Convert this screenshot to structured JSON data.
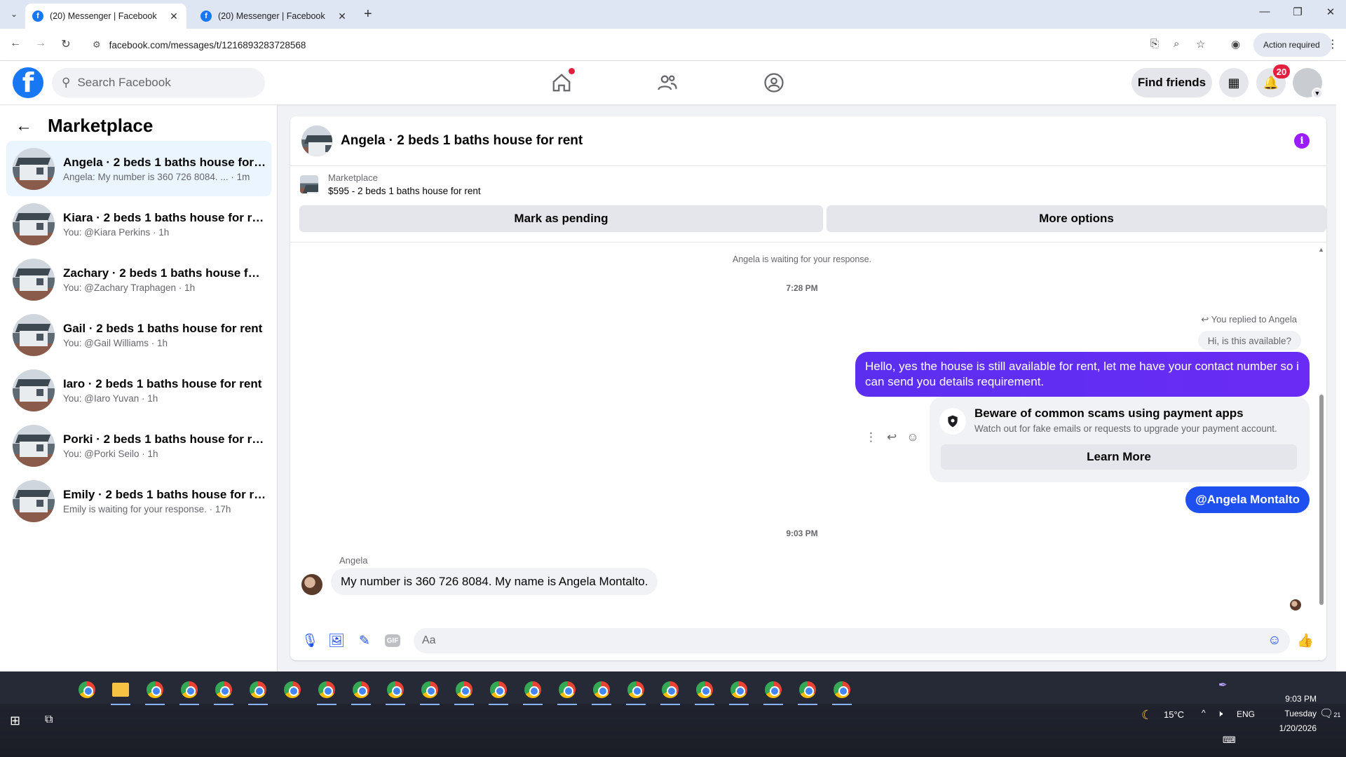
{
  "browser": {
    "tabs": [
      {
        "title": "(20) Messenger | Facebook",
        "active": true
      },
      {
        "title": "(20) Messenger | Facebook",
        "active": false
      }
    ],
    "url": "facebook.com/messages/t/1216893283728568",
    "action_required": "Action required"
  },
  "fb_header": {
    "search_placeholder": "Search Facebook",
    "find_friends": "Find friends",
    "notification_count": "20"
  },
  "sidebar": {
    "title": "Marketplace",
    "conversations": [
      {
        "name": "Angela · 2 beds 1 baths house for r...",
        "sub": "Angela: My number is 360 726 8084. ... · 1m",
        "active": true
      },
      {
        "name": "Kiara · 2 beds 1 baths house for rent",
        "sub": "You: @Kiara Perkins · 1h"
      },
      {
        "name": "Zachary · 2 beds 1 baths house for ...",
        "sub": "You: @Zachary Traphagen · 1h"
      },
      {
        "name": "Gail · 2 beds 1 baths house for rent",
        "sub": "You: @Gail Williams · 1h"
      },
      {
        "name": "Iaro · 2 beds 1 baths house for rent",
        "sub": "You: @Iaro Yuvan · 1h"
      },
      {
        "name": "Porki · 2 beds 1 baths house for rent",
        "sub": "You: @Porki Seilo · 1h"
      },
      {
        "name": "Emily · 2 beds 1 baths house for rent",
        "sub": "Emily is waiting for your response. · 17h"
      }
    ]
  },
  "chat": {
    "title": "Angela · 2 beds 1 baths house for rent",
    "listing_category": "Marketplace",
    "listing_desc": "$595 - 2 beds 1 baths house for rent",
    "mark_pending": "Mark as pending",
    "more_options": "More options",
    "waiting_note": "Angela is waiting for your response.",
    "time1": "7:28 PM",
    "reply_label": "You replied to Angela",
    "quoted": "Hi, is this available?",
    "outgoing": "Hello, yes the house is still available for rent, let me have your contact number so i can send you details requirement.",
    "scam_title": "Beware of common scams using payment apps",
    "scam_text": "Watch out for fake emails or requests to upgrade your payment account.",
    "learn_more": "Learn More",
    "mention": "@Angela Montalto",
    "time2": "9:03 PM",
    "sender": "Angela",
    "incoming": "My number is 360 726 8084.  My name is Angela Montalto.",
    "composer_placeholder": "Aa"
  },
  "taskbar": {
    "weather": "15°C",
    "lang": "ENG",
    "time": "9:03 PM",
    "day": "Tuesday",
    "date": "1/20/2026",
    "notif_count": "21"
  },
  "colors": {
    "fb_blue": "#1877f2",
    "outgoing_bubble": "#5b2ef0",
    "mention_bubble": "#1e50f0",
    "badge_red": "#e41e3f"
  }
}
